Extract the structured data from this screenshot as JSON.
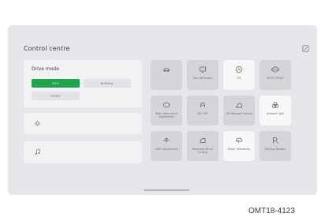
{
  "title": "Control centre",
  "drive_mode": {
    "label": "Drive mode",
    "modes": [
      "ECO",
      "NORMAL",
      "SPORT"
    ],
    "selected": "ECO"
  },
  "tiles": [
    {
      "label": "",
      "icon": "car-icon",
      "active": false
    },
    {
      "label": "Turn off screen",
      "icon": "screen-off-icon",
      "active": false
    },
    {
      "label": "P/S",
      "icon": "auto-hold-icon",
      "active": true
    },
    {
      "label": "AUTO HOLD",
      "icon": "auto-hold-icon",
      "active": false
    },
    {
      "label": "Rear view mirror adjustment",
      "icon": "mirror-icon",
      "active": false
    },
    {
      "label": "ESC OFF",
      "icon": "esc-off-icon",
      "active": false
    },
    {
      "label": "Hill Descent Control",
      "icon": "hill-descent-icon",
      "active": false
    },
    {
      "label": "Ambient light",
      "icon": "ambient-light-icon",
      "active": true
    },
    {
      "label": "HUD adjustment",
      "icon": "hud-icon",
      "active": false
    },
    {
      "label": "Rearview Mirror Folding",
      "icon": "mirror-fold-icon",
      "active": false
    },
    {
      "label": "Wiper Sensitivity",
      "icon": "wiper-icon",
      "active": true
    },
    {
      "label": "Parking Sensors",
      "icon": "parking-sensor-icon",
      "active": false
    }
  ],
  "caption": "OMT18-4123",
  "colors": {
    "accent": "#1fa34f",
    "screen_bg": "#e6e7ea",
    "tile_off": "#d3d5d9",
    "tile_on": "#f8f8fa"
  }
}
